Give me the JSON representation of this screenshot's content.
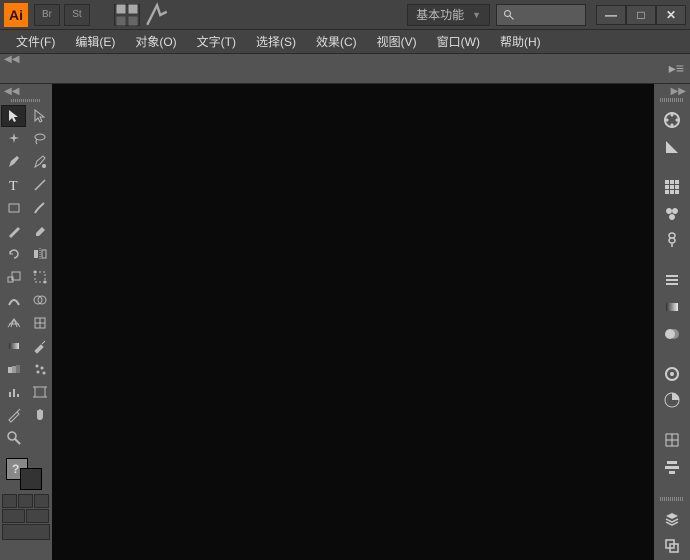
{
  "app": {
    "logo": "Ai",
    "bridge": "Br",
    "stock": "St"
  },
  "workspace": {
    "label": "基本功能"
  },
  "search": {
    "placeholder": ""
  },
  "window_controls": {
    "min": "—",
    "max": "□",
    "close": "✕"
  },
  "menu": {
    "file": "文件(F)",
    "edit": "编辑(E)",
    "object": "对象(O)",
    "type": "文字(T)",
    "select": "选择(S)",
    "effect": "效果(C)",
    "view": "视图(V)",
    "window": "窗口(W)",
    "help": "帮助(H)"
  }
}
